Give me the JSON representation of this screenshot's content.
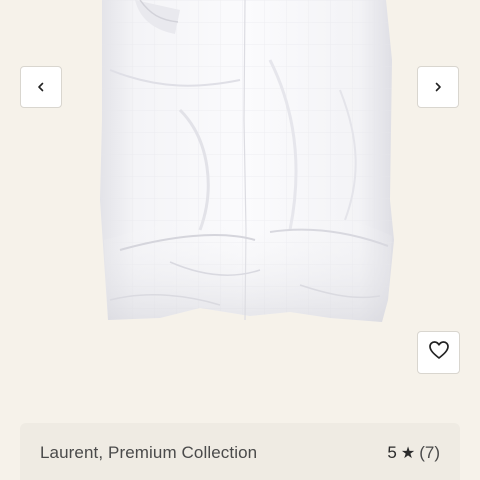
{
  "product": {
    "brand_label": "Laurent, Premium Collection",
    "rating_value": "5",
    "rating_count": "(7)",
    "rating_icon": "star-icon"
  },
  "gallery": {
    "prev_icon": "chevron-left-icon",
    "next_icon": "chevron-right-icon",
    "wishlist_icon": "heart-icon"
  },
  "colors": {
    "background": "#f6f2ea",
    "card": "#efebe3",
    "text": "#4a4a4a"
  }
}
